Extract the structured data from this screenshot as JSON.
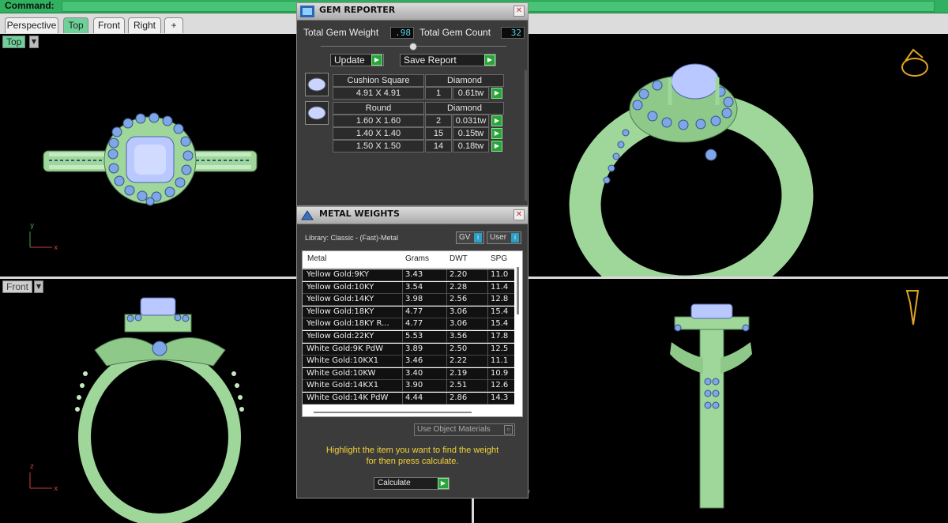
{
  "command": {
    "label": "Command:"
  },
  "tabs": [
    {
      "label": "Perspective"
    },
    {
      "label": "Top"
    },
    {
      "label": "Front"
    },
    {
      "label": "Right"
    },
    {
      "label": "+"
    }
  ],
  "viewports": {
    "top_label": "Top",
    "front_label": "Front"
  },
  "gem_reporter": {
    "title": "GEM REPORTER",
    "total_weight_label": "Total Gem Weight",
    "total_weight_value": ".98",
    "total_count_label": "Total Gem Count",
    "total_count_value": "32",
    "update_label": "Update",
    "save_report_label": "Save Report",
    "groups": [
      {
        "shape": "Cushion Square",
        "material": "Diamond",
        "rows": [
          {
            "size": "4.91 X 4.91",
            "count": "1",
            "weight": "0.61tw"
          }
        ]
      },
      {
        "shape": "Round",
        "material": "Diamond",
        "rows": [
          {
            "size": "1.60 X 1.60",
            "count": "2",
            "weight": "0.031tw"
          },
          {
            "size": "1.40 X 1.40",
            "count": "15",
            "weight": "0.15tw"
          },
          {
            "size": "1.50 X 1.50",
            "count": "14",
            "weight": "0.18tw"
          }
        ]
      }
    ]
  },
  "metal_weights": {
    "title": "METAL WEIGHTS",
    "library": "Library: Classic - (Fast)-Metal",
    "gv_label": "GV",
    "user_label": "User",
    "columns": [
      "Metal",
      "Grams",
      "DWT",
      "SPG"
    ],
    "rows": [
      {
        "metal": "Yellow Gold:9KY",
        "grams": "3.43",
        "dwt": "2.20",
        "spg": "11.0"
      },
      {
        "metal": "Yellow Gold:10KY",
        "grams": "3.54",
        "dwt": "2.28",
        "spg": "11.4"
      },
      {
        "metal": "Yellow Gold:14KY",
        "grams": "3.98",
        "dwt": "2.56",
        "spg": "12.8"
      },
      {
        "metal": "Yellow Gold:18KY",
        "grams": "4.77",
        "dwt": "3.06",
        "spg": "15.4"
      },
      {
        "metal": "Yellow Gold:18KY R...",
        "grams": "4.77",
        "dwt": "3.06",
        "spg": "15.4"
      },
      {
        "metal": "Yellow Gold:22KY",
        "grams": "5.53",
        "dwt": "3.56",
        "spg": "17.8"
      },
      {
        "metal": "White Gold:9K PdW",
        "grams": "3.89",
        "dwt": "2.50",
        "spg": "12.5"
      },
      {
        "metal": "White Gold:10KX1",
        "grams": "3.46",
        "dwt": "2.22",
        "spg": "11.1"
      },
      {
        "metal": "White Gold:10KW",
        "grams": "3.40",
        "dwt": "2.19",
        "spg": "10.9"
      },
      {
        "metal": "White Gold:14KX1",
        "grams": "3.90",
        "dwt": "2.51",
        "spg": "12.6"
      },
      {
        "metal": "White Gold:14K PdW",
        "grams": "4.44",
        "dwt": "2.86",
        "spg": "14.3"
      }
    ],
    "use_object_materials_label": "Use Object Materials",
    "hint_line1": "Highlight the item you want to find the weight",
    "hint_line2": "for then press calculate.",
    "calculate_label": "Calculate"
  },
  "colors": {
    "command_bar": "#2fb15f",
    "metal": "#9fd79b",
    "gem": "#7fa6e6",
    "value_text": "#57d3e3",
    "hint_text": "#f3d23a"
  },
  "axis": {
    "x": "x",
    "y": "y",
    "z": "z"
  }
}
